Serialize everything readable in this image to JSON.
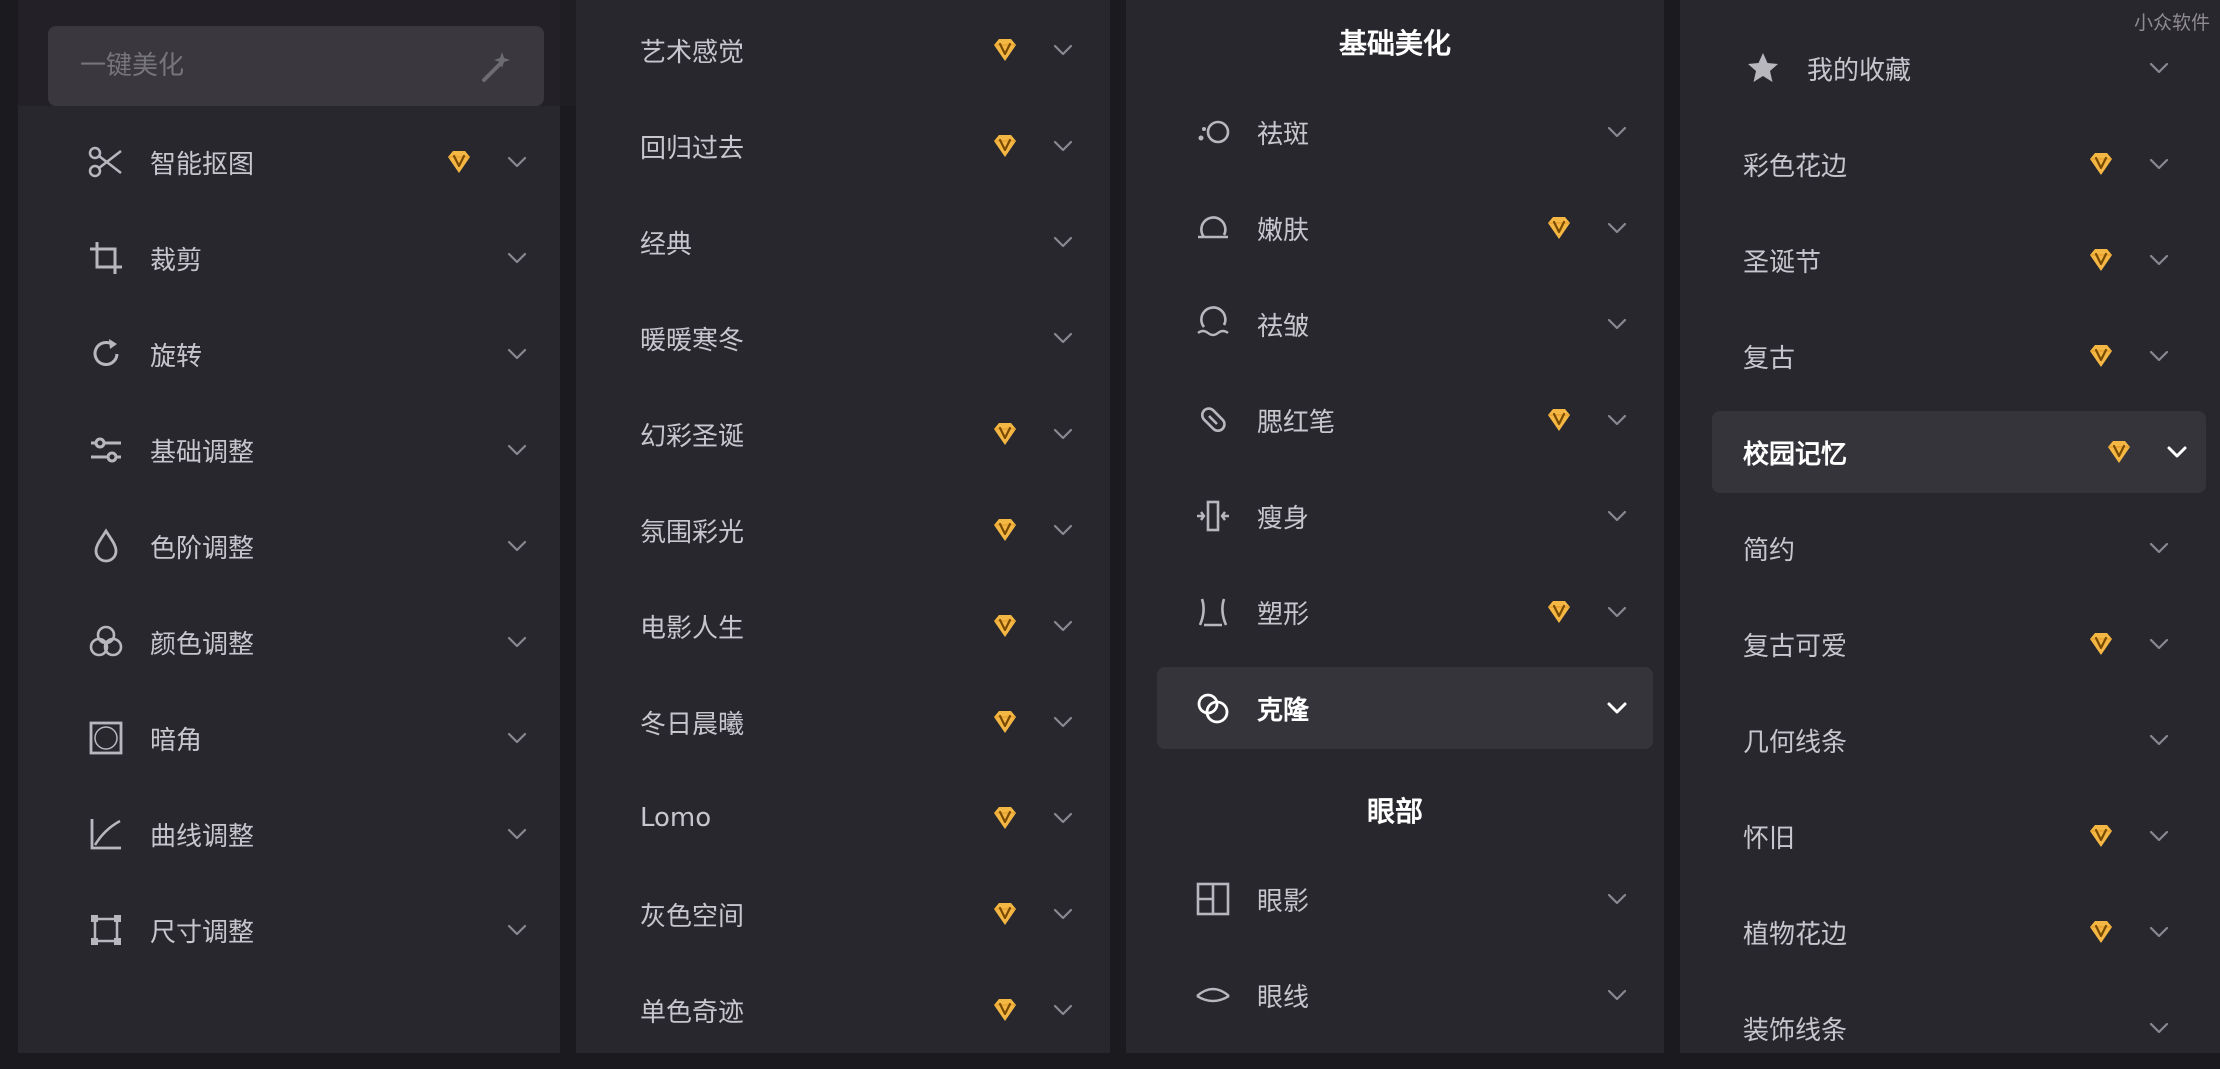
{
  "watermark": "小众软件",
  "search": {
    "placeholder": "一键美化"
  },
  "panel_tools": {
    "items": [
      {
        "label": "智能抠图",
        "vip": true,
        "icon": "scissors-icon"
      },
      {
        "label": "裁剪",
        "vip": false,
        "icon": "crop-icon"
      },
      {
        "label": "旋转",
        "vip": false,
        "icon": "rotate-icon"
      },
      {
        "label": "基础调整",
        "vip": false,
        "icon": "sliders-icon"
      },
      {
        "label": "色阶调整",
        "vip": false,
        "icon": "droplet-icon"
      },
      {
        "label": "颜色调整",
        "vip": false,
        "icon": "color-circles-icon"
      },
      {
        "label": "暗角",
        "vip": false,
        "icon": "vignette-icon"
      },
      {
        "label": "曲线调整",
        "vip": false,
        "icon": "curve-icon"
      },
      {
        "label": "尺寸调整",
        "vip": false,
        "icon": "resize-icon"
      }
    ]
  },
  "panel_filters": {
    "items": [
      {
        "label": "艺术感觉",
        "vip": true
      },
      {
        "label": "回归过去",
        "vip": true
      },
      {
        "label": "经典",
        "vip": false
      },
      {
        "label": "暖暖寒冬",
        "vip": false
      },
      {
        "label": "幻彩圣诞",
        "vip": true
      },
      {
        "label": "氛围彩光",
        "vip": true
      },
      {
        "label": "电影人生",
        "vip": true
      },
      {
        "label": "冬日晨曦",
        "vip": true
      },
      {
        "label": "Lomo",
        "vip": true
      },
      {
        "label": "灰色空间",
        "vip": true
      },
      {
        "label": "单色奇迹",
        "vip": true
      }
    ]
  },
  "panel_beauty": {
    "section_basic": "基础美化",
    "basic_items": [
      {
        "label": "祛斑",
        "vip": false,
        "icon": "spot-remove-icon"
      },
      {
        "label": "嫩肤",
        "vip": true,
        "icon": "skin-smooth-icon"
      },
      {
        "label": "祛皱",
        "vip": false,
        "icon": "wrinkle-remove-icon"
      },
      {
        "label": "腮红笔",
        "vip": true,
        "icon": "blush-pen-icon"
      },
      {
        "label": "瘦身",
        "vip": false,
        "icon": "slim-body-icon"
      },
      {
        "label": "塑形",
        "vip": true,
        "icon": "reshape-icon"
      },
      {
        "label": "克隆",
        "vip": false,
        "icon": "clone-icon",
        "active": true
      }
    ],
    "section_eyes": "眼部",
    "eye_items": [
      {
        "label": "眼影",
        "vip": false,
        "icon": "eye-shadow-icon"
      },
      {
        "label": "眼线",
        "vip": false,
        "icon": "eyeliner-icon"
      }
    ]
  },
  "panel_frames": {
    "items": [
      {
        "label": "我的收藏",
        "vip": false,
        "icon": "star-icon"
      },
      {
        "label": "彩色花边",
        "vip": true
      },
      {
        "label": "圣诞节",
        "vip": true
      },
      {
        "label": "复古",
        "vip": true
      },
      {
        "label": "校园记忆",
        "vip": true,
        "active": true
      },
      {
        "label": "简约",
        "vip": false
      },
      {
        "label": "复古可爱",
        "vip": true
      },
      {
        "label": "几何线条",
        "vip": false
      },
      {
        "label": "怀旧",
        "vip": true
      },
      {
        "label": "植物花边",
        "vip": true
      },
      {
        "label": "装饰线条",
        "vip": false
      }
    ]
  },
  "colors": {
    "vip_gold": "#f5b743",
    "panel": "#29272e",
    "active_row": "#36343b"
  }
}
